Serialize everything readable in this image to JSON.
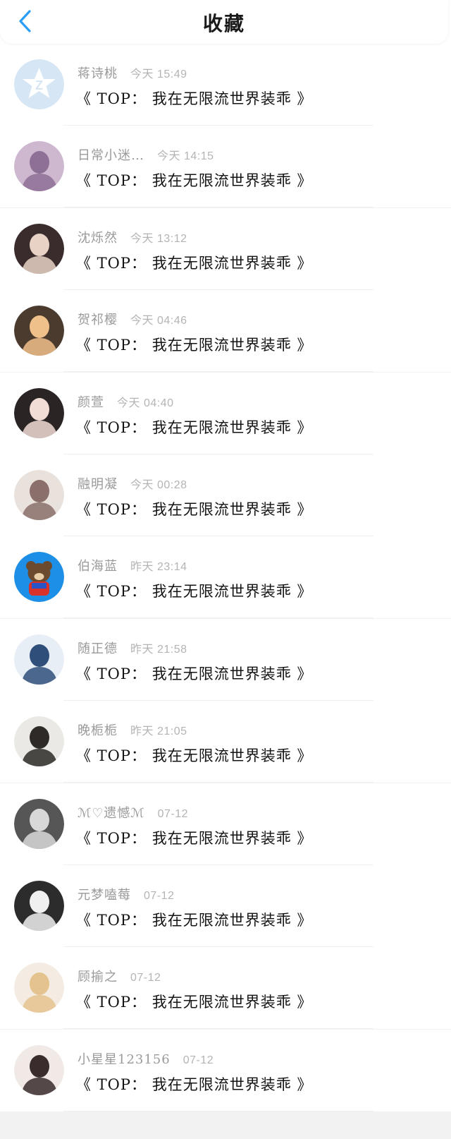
{
  "header": {
    "title": "收藏",
    "back_icon": "chevron-left-icon",
    "accent_color": "#2a9df4"
  },
  "items": [
    {
      "username": "蒋诗桃",
      "time": "今天 15:49",
      "title": "《 TOP： 我在无限流世界装乖 》",
      "avatar": "qq-star-icon"
    },
    {
      "username": "日常小迷…",
      "time": "今天 14:15",
      "title": "《 TOP： 我在无限流世界装乖 》",
      "avatar": "user-photo"
    },
    {
      "username": "沈烁然",
      "time": "今天 13:12",
      "title": "《 TOP： 我在无限流世界装乖 》",
      "avatar": "user-photo"
    },
    {
      "username": "贺祁樱",
      "time": "今天 04:46",
      "title": "《 TOP： 我在无限流世界装乖 》",
      "avatar": "user-photo"
    },
    {
      "username": "颜萱",
      "time": "今天 04:40",
      "title": "《 TOP： 我在无限流世界装乖 》",
      "avatar": "user-photo"
    },
    {
      "username": "融明凝",
      "time": "今天 00:28",
      "title": "《 TOP： 我在无限流世界装乖 》",
      "avatar": "user-illustration"
    },
    {
      "username": "伯海蓝",
      "time": "昨天 23:14",
      "title": "《 TOP： 我在无限流世界装乖 》",
      "avatar": "cartoon-bear"
    },
    {
      "username": "随正德",
      "time": "昨天 21:58",
      "title": "《 TOP： 我在无限流世界装乖 》",
      "avatar": "user-illustration"
    },
    {
      "username": "晚栀栀",
      "time": "昨天 21:05",
      "title": "《 TOP： 我在无限流世界装乖 》",
      "avatar": "user-illustration"
    },
    {
      "username": "ℳ♡遗憾ℳ",
      "time": "07-12",
      "title": "《 TOP： 我在无限流世界装乖 》",
      "avatar": "user-photo"
    },
    {
      "username": "元梦嗑莓",
      "time": "07-12",
      "title": "《 TOP： 我在无限流世界装乖 》",
      "avatar": "user-illustration"
    },
    {
      "username": "顾揄之",
      "time": "07-12",
      "title": "《 TOP： 我在无限流世界装乖 》",
      "avatar": "user-illustration"
    },
    {
      "username": "小星星123156",
      "time": "07-12",
      "title": "《 TOP： 我在无限流世界装乖 》",
      "avatar": "user-illustration"
    }
  ]
}
